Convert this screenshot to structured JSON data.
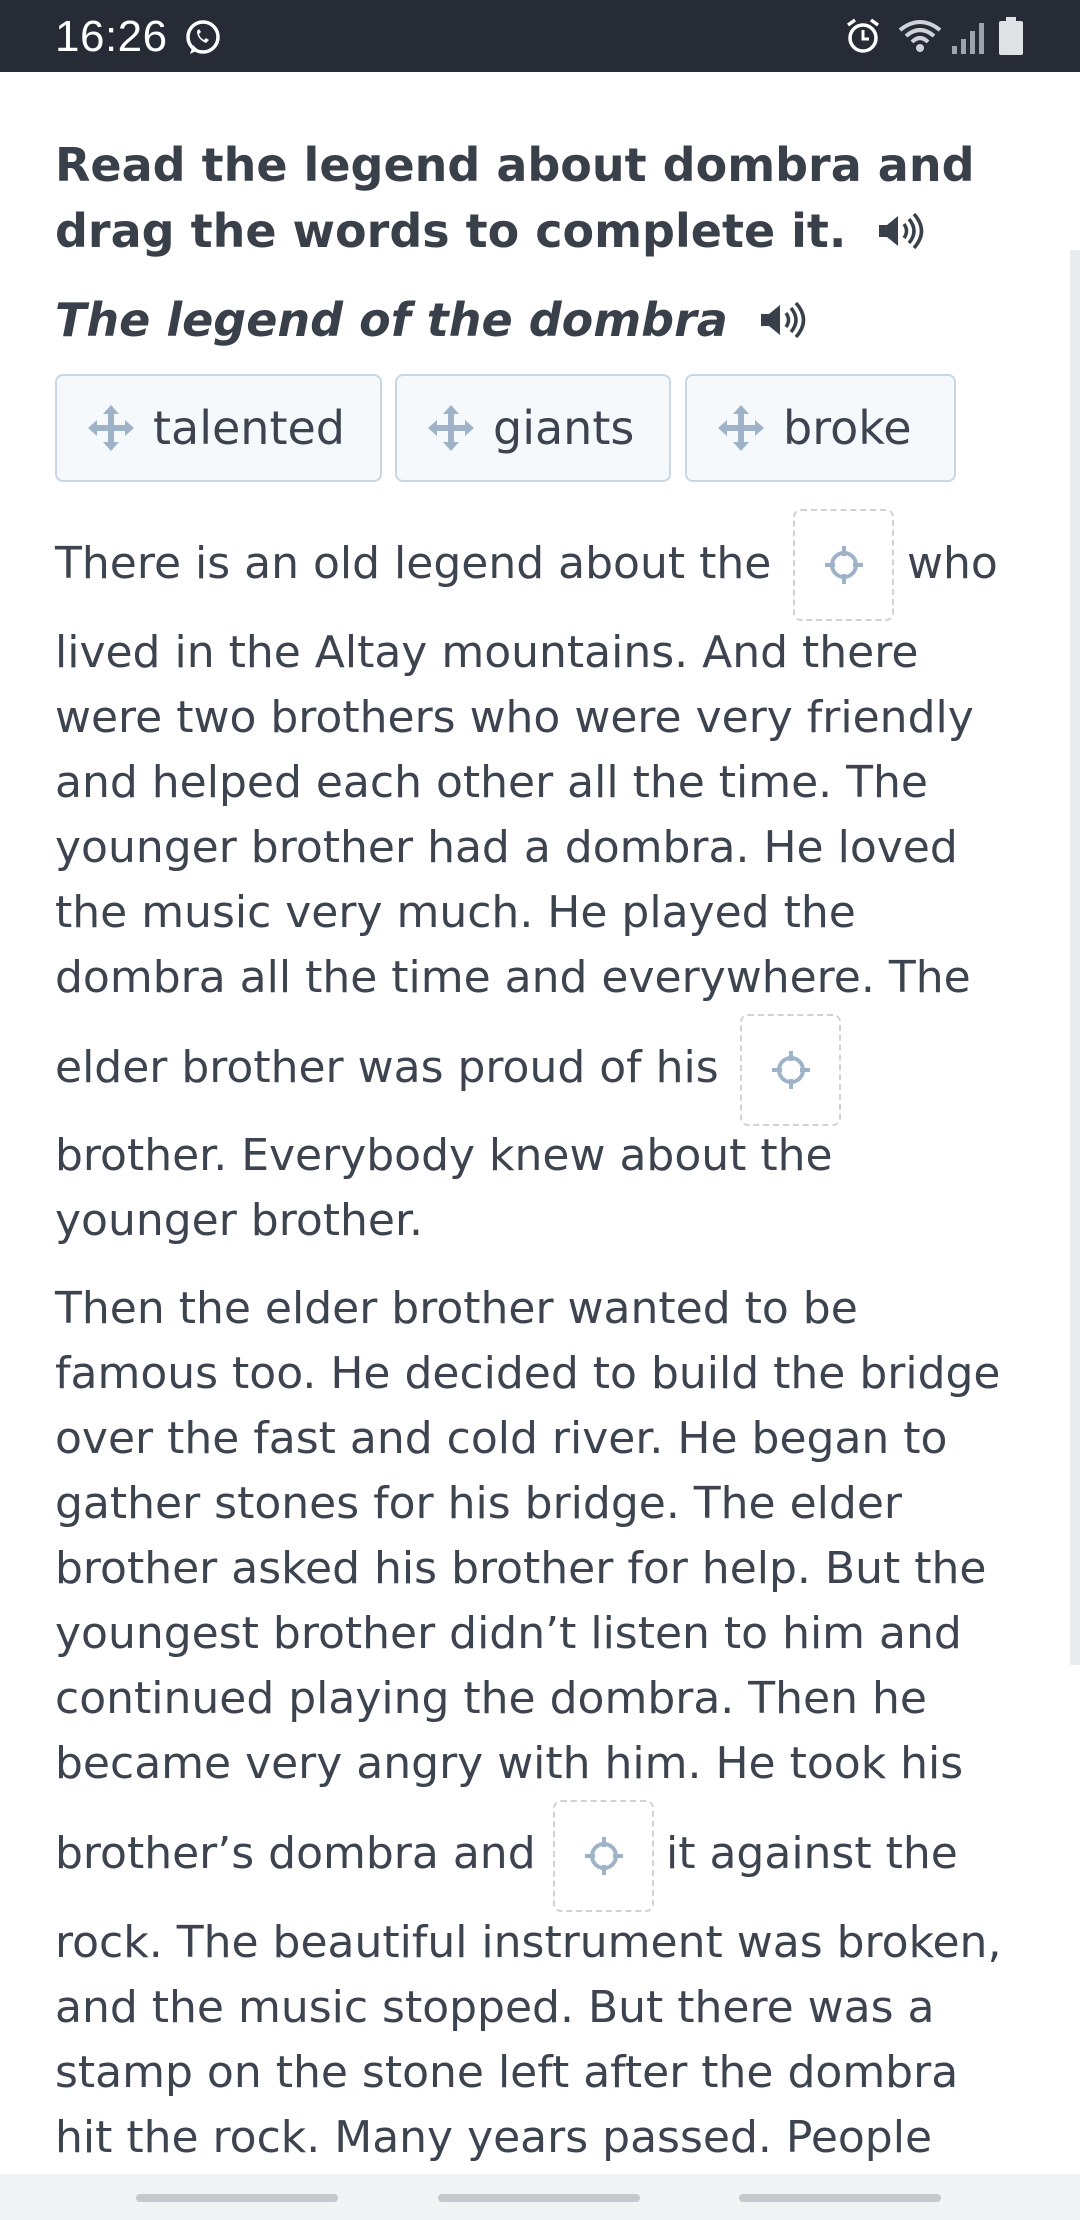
{
  "status_bar": {
    "time": "16:26",
    "icons": [
      "whatsapp-icon",
      "alarm-icon",
      "wifi-icon",
      "signal-icon",
      "battery-icon"
    ]
  },
  "instruction": "Read the legend about dombra and drag the words to complete it.",
  "title": "The legend of the  dombra",
  "word_bank": [
    "talented",
    "giants",
    "broke"
  ],
  "passage": {
    "line_1a": "There is an old legend about the",
    "line_1b": "who",
    "line_2": "lived in the Altay mountains. And there",
    "line_3": "were two brothers who were very friendly",
    "line_4": "and helped each other all the time. The",
    "line_5": "younger brother had a dombra. He loved",
    "line_6": "the music very much. He played the",
    "line_7": "dombra all the time and everywhere. The",
    "line_8a": "elder brother was proud of his",
    "line_9": " brother. Everybody knew about the",
    "line_10": "younger brother.",
    "p2_1": "Then the elder brother wanted to be",
    "p2_2": "famous too. He decided to build the bridge",
    "p2_3": "over the fast and cold river. He began to",
    "p2_4": "gather stones for his bridge. The elder",
    "p2_5": "brother asked his brother for help. But the",
    "p2_6": "youngest brother didn’t listen to him and",
    "p2_7": "continued playing the dombra. Then he",
    "p2_8": "became very angry with him. He took his",
    "p2_9a": "brother’s dombra and",
    "p2_9b": "it against the",
    "p2_10": "rock. The beautiful instrument was broken,",
    "p2_11": "and the music stopped. But there was a",
    "p2_12": "stamp on the stone left after the dombra",
    "p2_13": "hit the rock. Many years passed. People"
  },
  "colors": {
    "status_bar": "#262b36",
    "text": "#3d4450",
    "chip_border": "#c9d6e3",
    "chip_bg": "#f5f9fc",
    "dropzone_border": "#cfd3d8",
    "icon": "#9fb3c8"
  }
}
